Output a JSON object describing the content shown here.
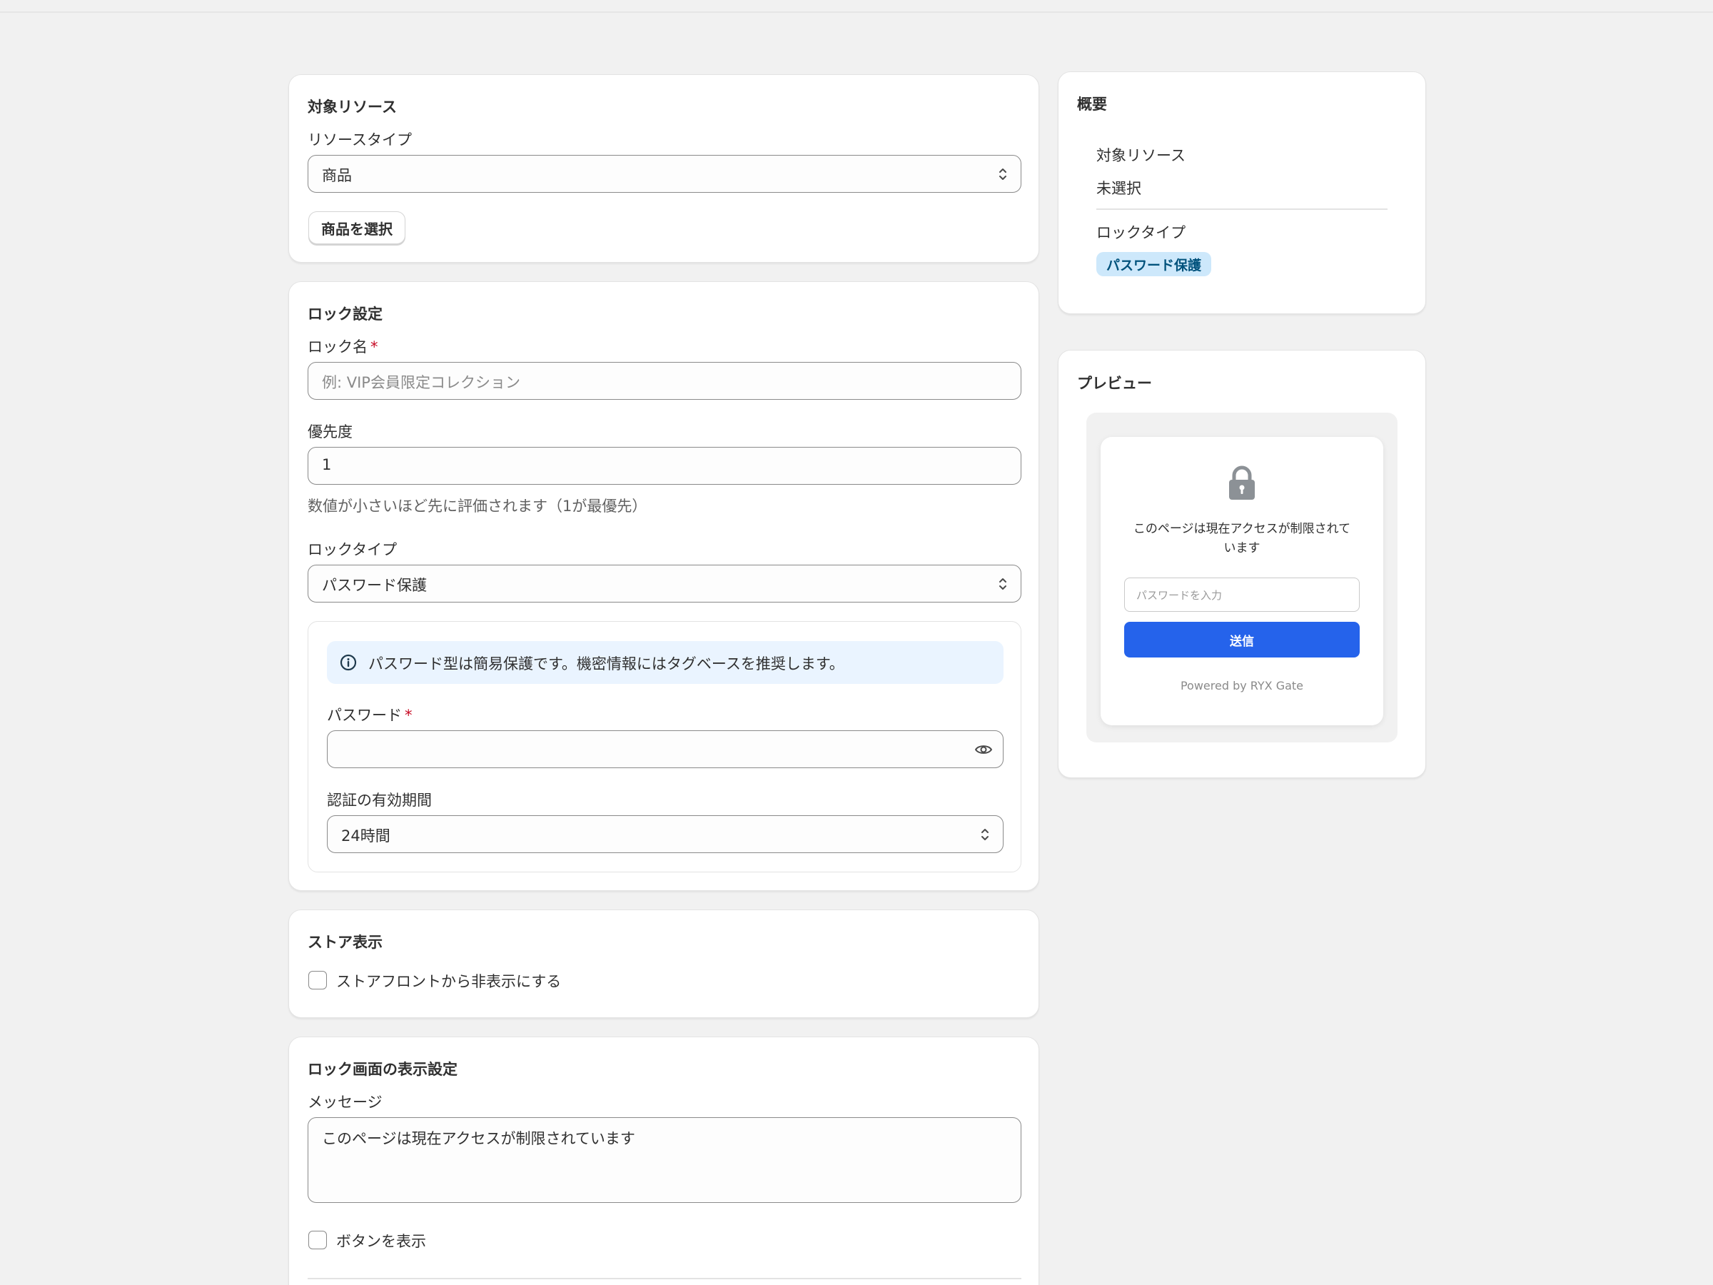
{
  "target_resource": {
    "title": "対象リソース",
    "resource_type_label": "リソースタイプ",
    "resource_type_value": "商品",
    "select_button": "商品を選択"
  },
  "lock_settings": {
    "title": "ロック設定",
    "lock_name_label": "ロック名",
    "required_mark": "*",
    "lock_name_placeholder": "例: VIP会員限定コレクション",
    "priority_label": "優先度",
    "priority_value": "1",
    "priority_help": "数値が小さいほど先に評価されます（1が最優先）",
    "lock_type_label": "ロックタイプ",
    "lock_type_value": "パスワード保護",
    "info_banner": "パスワード型は簡易保護です。機密情報にはタグベースを推奨します。",
    "password_label": "パスワード",
    "password_value": "",
    "auth_period_label": "認証の有効期間",
    "auth_period_value": "24時間"
  },
  "store_display": {
    "title": "ストア表示",
    "hide_label": "ストアフロントから非表示にする",
    "hide_checked": false
  },
  "lock_screen": {
    "title": "ロック画面の表示設定",
    "message_label": "メッセージ",
    "message_value": "このページは現在アクセスが制限されています",
    "show_button_label": "ボタンを表示",
    "show_button_checked": false
  },
  "summary": {
    "title": "概要",
    "target_label": "対象リソース",
    "target_value": "未選択",
    "lock_type_label": "ロックタイプ",
    "lock_type_badge": "パスワード保護"
  },
  "preview": {
    "title": "プレビュー",
    "message_line1": "このページは現在アクセスが制限されて",
    "message_line2": "います",
    "password_placeholder": "パスワードを入力",
    "submit_label": "送信",
    "powered_by": "Powered by RYX Gate"
  },
  "icons": {
    "chevron": "chevron-up-down-icon",
    "eye": "eye-icon",
    "info": "info-icon",
    "lock": "lock-icon"
  },
  "colors": {
    "accent": "#2563eb",
    "required": "#c70a24",
    "badge_bg": "#cde8fb",
    "banner_bg": "#eaf4ff"
  }
}
